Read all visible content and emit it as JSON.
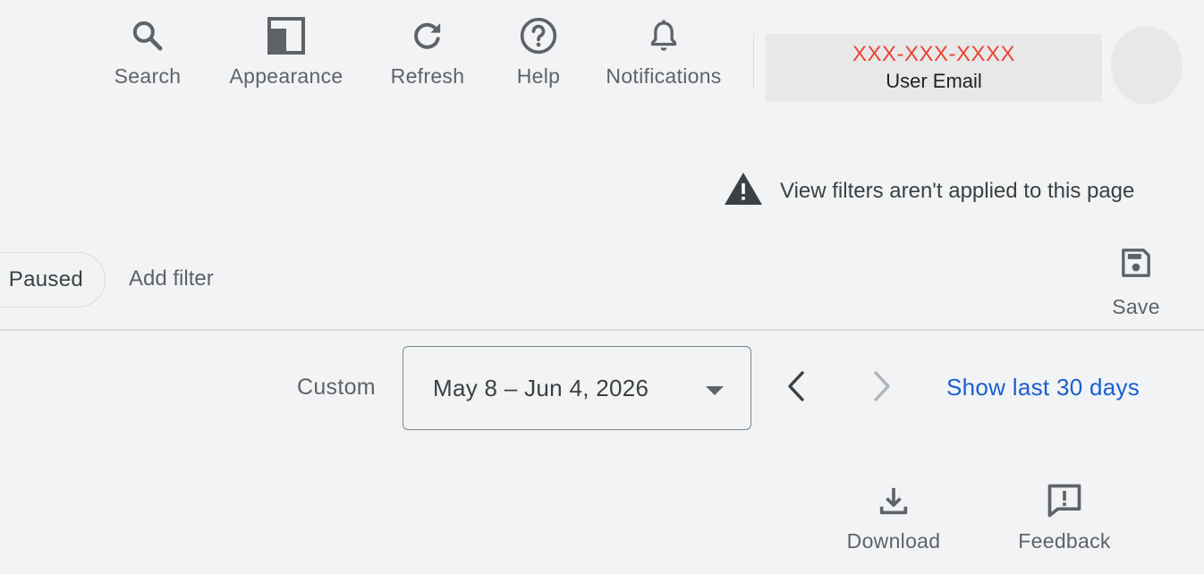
{
  "toolbar": {
    "search_label": "Search",
    "appearance_label": "Appearance",
    "refresh_label": "Refresh",
    "help_label": "Help",
    "notifications_label": "Notifications"
  },
  "account": {
    "phone": "XXX-XXX-XXXX",
    "email": "User Email",
    "phone_color": "#ea4335"
  },
  "warning": {
    "icon": "warning-icon",
    "text": "View filters aren't applied to this page"
  },
  "filters": {
    "chip_label": "Paused",
    "add_filter_label": "Add filter",
    "save_label": "Save"
  },
  "date_range": {
    "preset_label": "Custom",
    "selected_range": "May 8 – Jun 4, 2026",
    "show_last_label": "Show last 30 days",
    "link_color": "#1a5fd1"
  },
  "actions": {
    "download_label": "Download",
    "feedback_label": "Feedback"
  },
  "icons": {
    "search": "search-icon",
    "appearance": "appearance-icon",
    "refresh": "refresh-icon",
    "help": "help-icon",
    "notifications": "bell-icon",
    "save": "save-icon",
    "download": "download-icon",
    "feedback": "feedback-icon",
    "prev": "chevron-left-icon",
    "next": "chevron-right-icon",
    "dropdown": "caret-down-icon"
  }
}
